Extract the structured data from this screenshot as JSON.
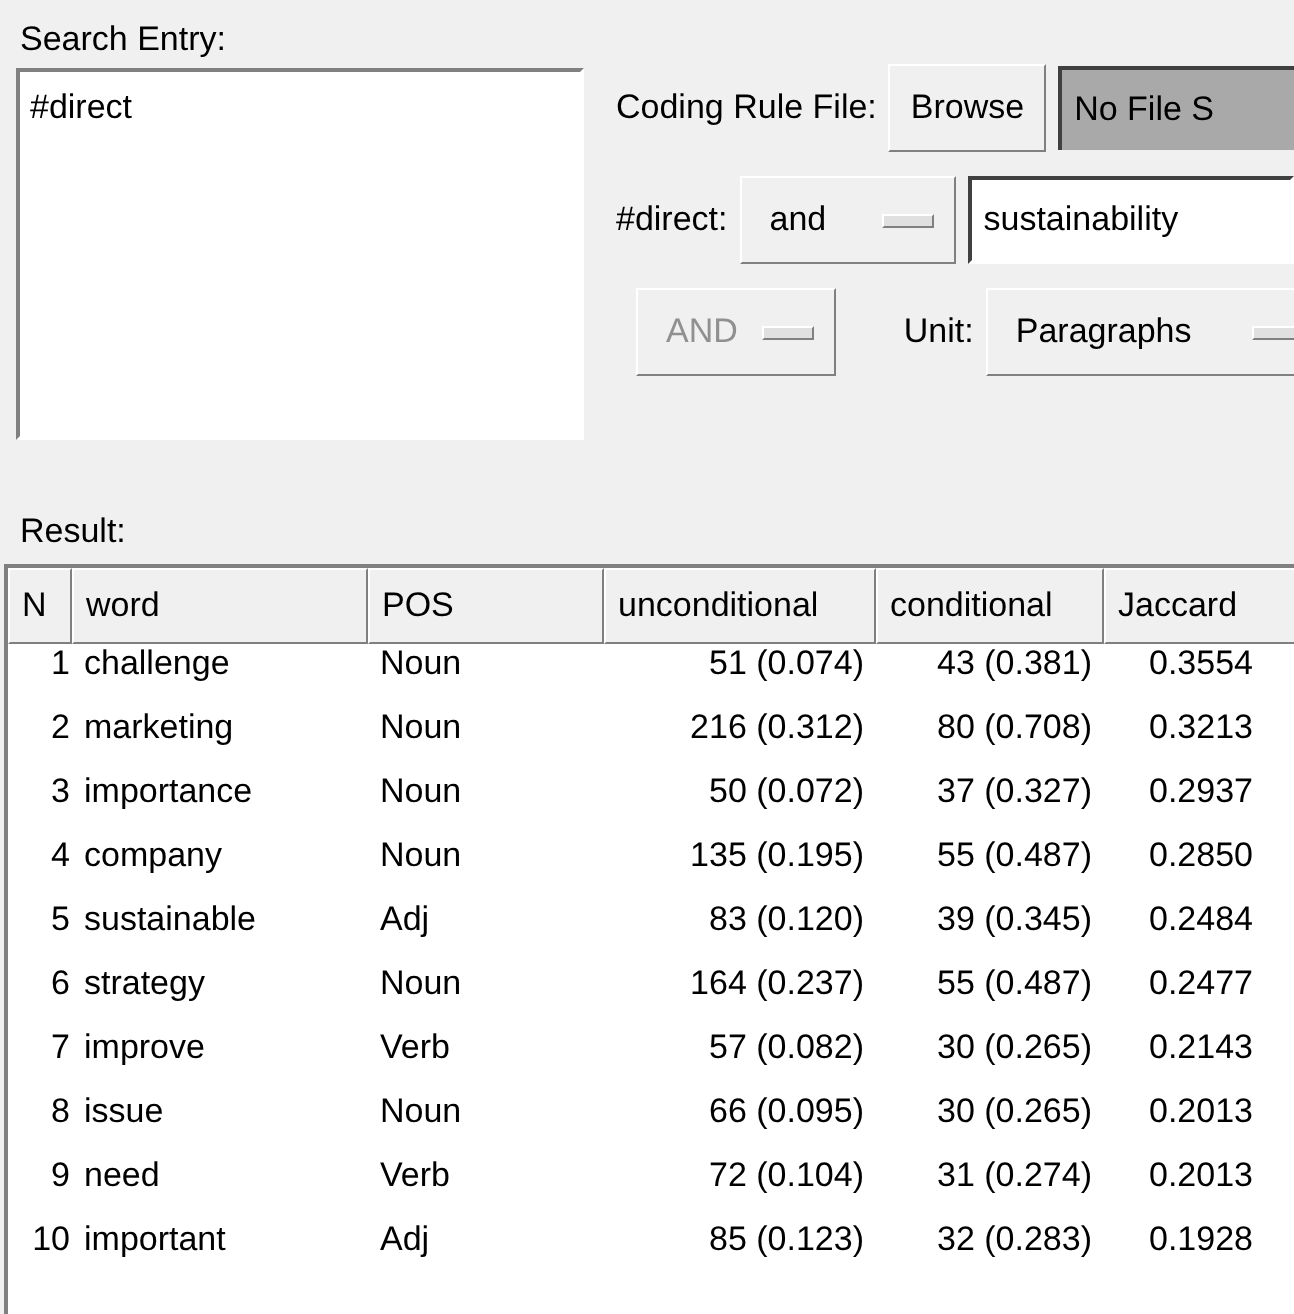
{
  "search_entry": {
    "label": "Search Entry:",
    "value": "#direct"
  },
  "coding_rule": {
    "label": "Coding Rule File:",
    "button": "Browse",
    "file": "No File S"
  },
  "condition": {
    "label": "#direct:",
    "operator": {
      "value": "and",
      "disabled": false
    },
    "term": "sustainability"
  },
  "combine": {
    "operator": {
      "value": "AND",
      "disabled": true
    },
    "unit_label": "Unit:",
    "unit": {
      "value": "Paragraphs",
      "disabled": false
    }
  },
  "result": {
    "label": "Result:",
    "columns": [
      "N",
      "word",
      "POS",
      "unconditional",
      "conditional",
      "Jaccard"
    ],
    "rows": [
      [
        "1",
        "challenge",
        "Noun",
        "51 (0.074)",
        "43 (0.381)",
        "0.3554"
      ],
      [
        "2",
        "marketing",
        "Noun",
        "216 (0.312)",
        "80 (0.708)",
        "0.3213"
      ],
      [
        "3",
        "importance",
        "Noun",
        "50 (0.072)",
        "37 (0.327)",
        "0.2937"
      ],
      [
        "4",
        "company",
        "Noun",
        "135 (0.195)",
        "55 (0.487)",
        "0.2850"
      ],
      [
        "5",
        "sustainable",
        "Adj",
        "83 (0.120)",
        "39 (0.345)",
        "0.2484"
      ],
      [
        "6",
        "strategy",
        "Noun",
        "164 (0.237)",
        "55 (0.487)",
        "0.2477"
      ],
      [
        "7",
        "improve",
        "Verb",
        "57 (0.082)",
        "30 (0.265)",
        "0.2143"
      ],
      [
        "8",
        "issue",
        "Noun",
        "66 (0.095)",
        "30 (0.265)",
        "0.2013"
      ],
      [
        "9",
        "need",
        "Verb",
        "72 (0.104)",
        "31 (0.274)",
        "0.2013"
      ],
      [
        "10",
        "important",
        "Adj",
        "85 (0.123)",
        "32 (0.283)",
        "0.1928"
      ]
    ]
  }
}
